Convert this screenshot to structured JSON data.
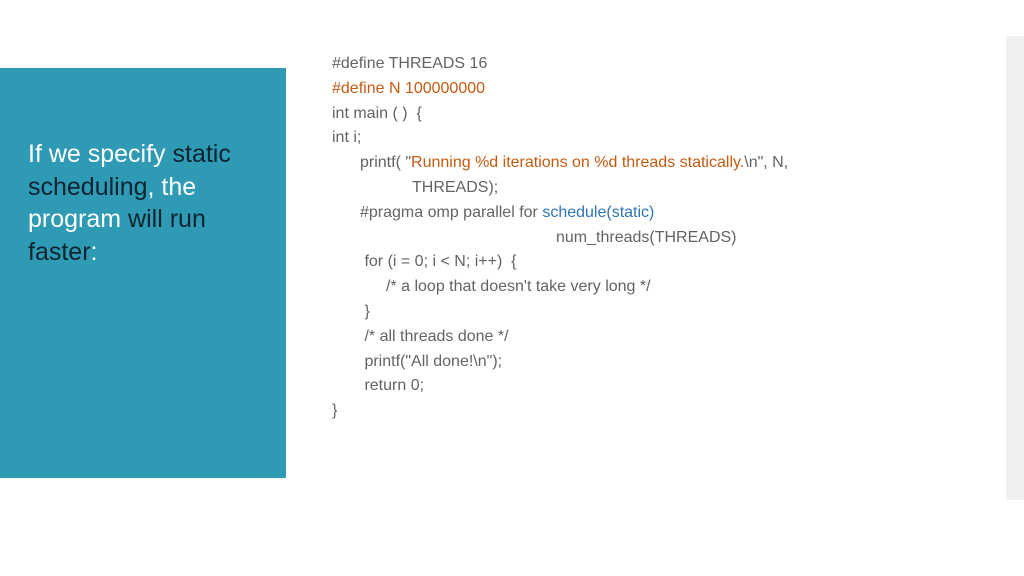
{
  "title": {
    "l1a": "If we specify ",
    "l1b": "static scheduling",
    "l1c": ", the program ",
    "l1d": "will run faster",
    "l1e": ":"
  },
  "code": {
    "l01": "#define THREADS 16",
    "l02": "#define N 100000000",
    "l03": "int main ( )  {",
    "l04": "int i;",
    "l05a": "printf( \"",
    "l05b": "Running %d iterations on %d threads statically.",
    "l05c": "\\n\", N,",
    "l06": "THREADS);",
    "l07a": "#pragma omp parallel for ",
    "l07b": "schedule(static)",
    "l08": "num_threads(THREADS)",
    "l09": " for (i = 0; i < N; i++)  {",
    "l10": "/* a loop that doesn't take very long */",
    "l11": " }",
    "l12": " /* all threads done */",
    "l13": " printf(\"All done!\\n\");",
    "l14": " return 0;",
    "l15": "}"
  }
}
